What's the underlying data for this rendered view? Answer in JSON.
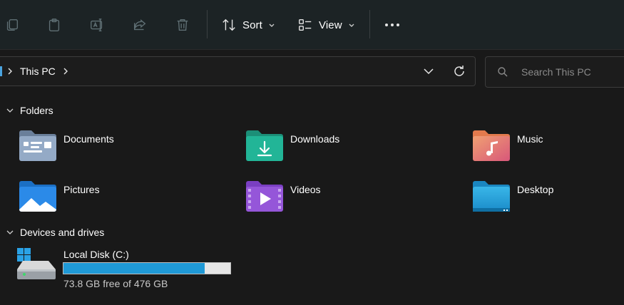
{
  "toolbar": {
    "sort_label": "Sort",
    "view_label": "View",
    "icons": [
      "copy-icon",
      "paste-icon",
      "rename-icon",
      "share-icon",
      "delete-icon",
      "more-icon"
    ]
  },
  "address": {
    "breadcrumb": "This PC",
    "search_placeholder": "Search This PC"
  },
  "sections": {
    "folders_label": "Folders",
    "drives_label": "Devices and drives"
  },
  "folders": [
    {
      "label": "Documents",
      "icon": "documents-folder-icon"
    },
    {
      "label": "Downloads",
      "icon": "downloads-folder-icon"
    },
    {
      "label": "Music",
      "icon": "music-folder-icon"
    },
    {
      "label": "Pictures",
      "icon": "pictures-folder-icon"
    },
    {
      "label": "Videos",
      "icon": "videos-folder-icon"
    },
    {
      "label": "Desktop",
      "icon": "desktop-folder-icon"
    }
  ],
  "drives": [
    {
      "label": "Local Disk (C:)",
      "free_text": "73.8 GB free of 476 GB",
      "used_fraction": 0.845,
      "bar_color": "#1f99d6"
    }
  ],
  "colors": {
    "background": "#191919",
    "toolbar": "#1c2325",
    "accent": "#4aa3df"
  }
}
